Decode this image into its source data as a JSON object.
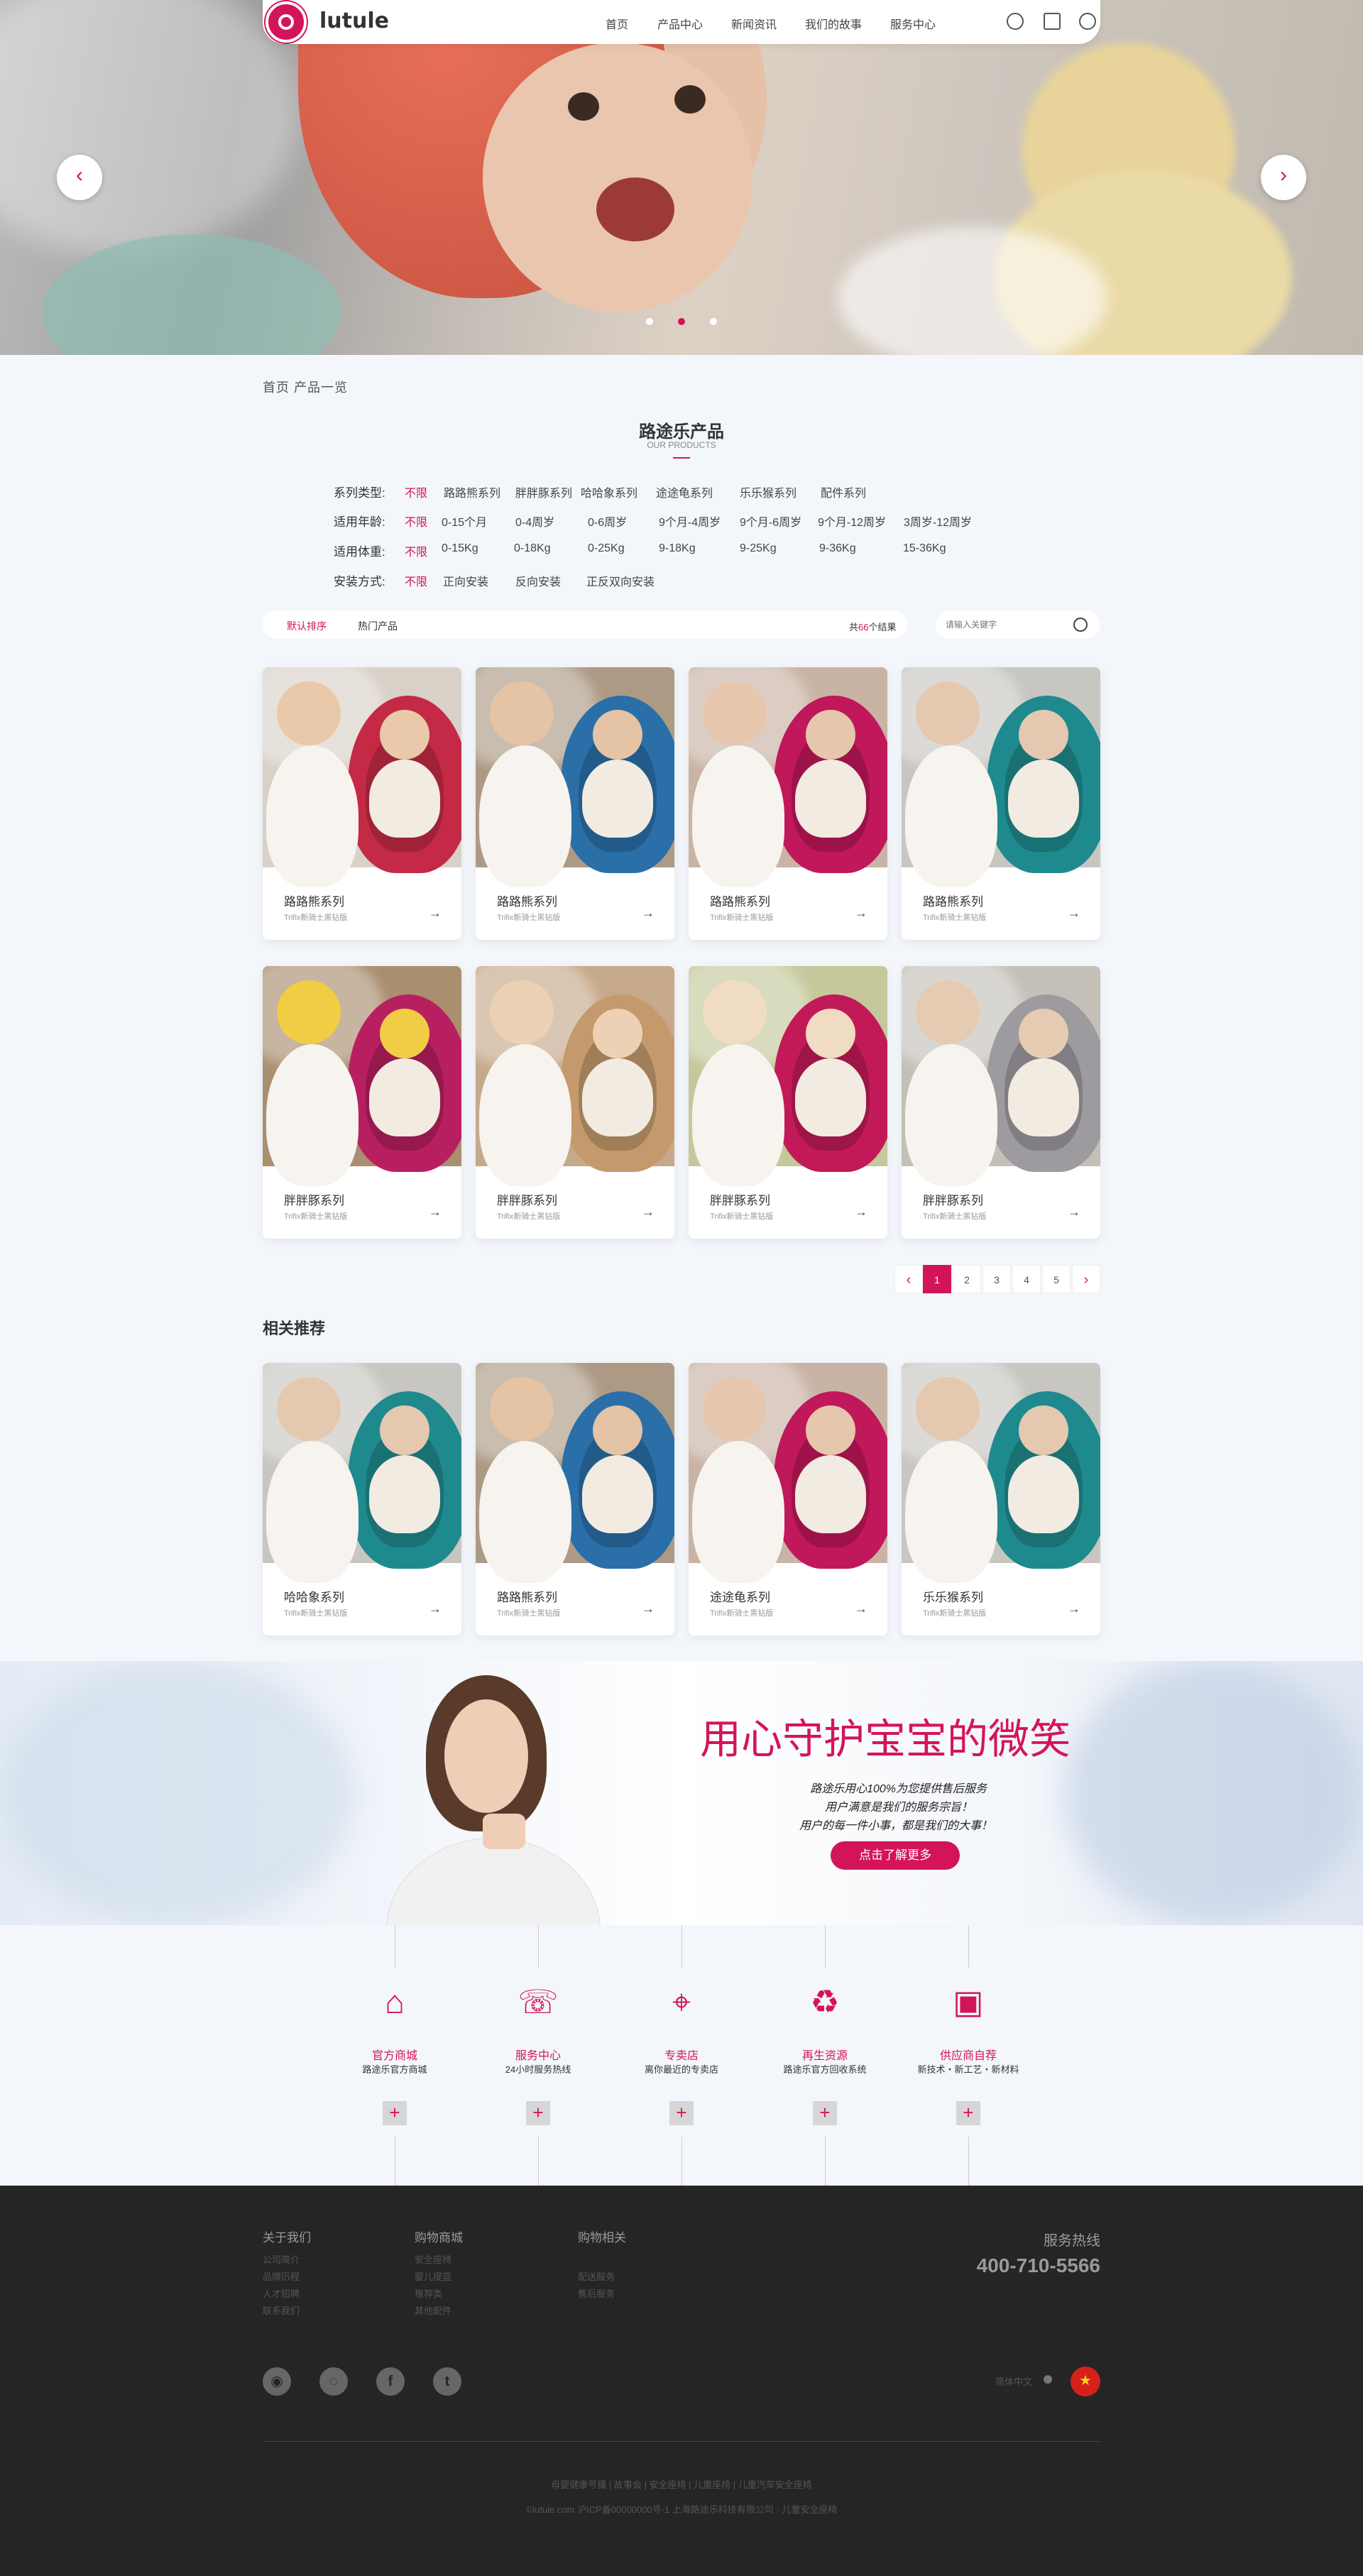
{
  "brand": {
    "logo_text": "lutule",
    "primary_color": "#d4145a"
  },
  "nav": {
    "items": [
      "首页",
      "产品中心",
      "新闻资讯",
      "我们的故事",
      "服务中心"
    ],
    "icons": [
      "search-icon",
      "cart-icon",
      "user-icon"
    ]
  },
  "hero": {
    "slides": 3,
    "active_slide": 2
  },
  "breadcrumb": "首页  产品一览",
  "section": {
    "title": "路途乐产品",
    "subtitle": "OUR PRODUCTS"
  },
  "filters": [
    {
      "label": "系列类型:",
      "active": "不限",
      "options": [
        "路路熊系列",
        "胖胖豚系列",
        "哈哈象系列",
        "途途龟系列",
        "乐乐猴系列",
        "配件系列"
      ]
    },
    {
      "label": "适用年龄:",
      "active": "不限",
      "options": [
        "0-15个月",
        "0-4周岁",
        "0-6周岁",
        "9个月-4周岁",
        "9个月-6周岁",
        "9个月-12周岁",
        "3周岁-12周岁"
      ]
    },
    {
      "label": "适用体重:",
      "active": "不限",
      "options": [
        "0-15Kg",
        "0-18Kg",
        "0-25Kg",
        "9-18Kg",
        "9-25Kg",
        "9-36Kg",
        "15-36Kg"
      ]
    },
    {
      "label": "安装方式:",
      "active": "不限",
      "options": [
        "正向安装",
        "反向安装",
        "正反双向安装"
      ]
    }
  ],
  "sort": {
    "default": "默认排序",
    "hot": "热门产品",
    "count_prefix": "共",
    "count": "66",
    "count_suffix": "个结果",
    "search_placeholder": "请输入关键字"
  },
  "products_row1": [
    {
      "name": "路路熊系列",
      "sub": "Trifix新骑士黑钻版"
    },
    {
      "name": "路路熊系列",
      "sub": "Trifix新骑士黑钻版"
    },
    {
      "name": "路路熊系列",
      "sub": "Trifix新骑士黑钻版"
    },
    {
      "name": "路路熊系列",
      "sub": "Trifix新骑士黑钻版"
    }
  ],
  "products_row2": [
    {
      "name": "胖胖豚系列",
      "sub": "Trifix新骑士黑钻版"
    },
    {
      "name": "胖胖豚系列",
      "sub": "Trifix新骑士黑钻版"
    },
    {
      "name": "胖胖豚系列",
      "sub": "Trifix新骑士黑钻版"
    },
    {
      "name": "胖胖豚系列",
      "sub": "Trifix新骑士黑钻版"
    }
  ],
  "pagination": {
    "prev": "‹",
    "pages": [
      "1",
      "2",
      "3",
      "4",
      "5"
    ],
    "current": "1",
    "next": "›"
  },
  "related": {
    "title": "相关推荐",
    "items": [
      {
        "name": "哈哈象系列",
        "sub": "Trifix新骑士黑钻版"
      },
      {
        "name": "路路熊系列",
        "sub": "Trifix新骑士黑钻版"
      },
      {
        "name": "途途龟系列",
        "sub": "Trifix新骑士黑钻版"
      },
      {
        "name": "乐乐猴系列",
        "sub": "Trifix新骑士黑钻版"
      }
    ]
  },
  "banner": {
    "headline": "用心守护宝宝的微笑",
    "lines": [
      "路途乐用心100%为您提供售后服务",
      "用户满意是我们的服务宗旨！",
      "用户的每一件小事，都是我们的大事！"
    ],
    "button": "点击了解更多"
  },
  "services": [
    {
      "title": "官方商城",
      "sub": "路途乐官方商城",
      "icon": "store-icon",
      "glyph": "⌂"
    },
    {
      "title": "服务中心",
      "sub": "24小时服务热线",
      "icon": "phone-24-icon",
      "glyph": "☏"
    },
    {
      "title": "专卖店",
      "sub": "离你最近的专卖店",
      "icon": "location-pin-icon",
      "glyph": "⌖"
    },
    {
      "title": "再生资源",
      "sub": "路途乐官方回收系统",
      "icon": "recycle-icon",
      "glyph": "♻"
    },
    {
      "title": "供应商自荐",
      "sub": "新技术・新工艺・新材料",
      "icon": "chip-icon",
      "glyph": "▣"
    }
  ],
  "footer": {
    "cols": [
      {
        "title": "关于我们",
        "links": [
          "公司简介",
          "品牌历程",
          "人才招聘",
          "联系我们"
        ]
      },
      {
        "title": "购物商城",
        "links": [
          "安全座椅",
          "婴儿提篮",
          "推荐类",
          "其他配件"
        ]
      },
      {
        "title": "购物相关",
        "links": [
          "",
          "配送服务",
          "售后服务"
        ]
      }
    ],
    "hotline_label": "服务热线",
    "hotline": "400-710-5566",
    "lang": "简体中文",
    "bottom_links": [
      "母婴健康号播",
      "故事会",
      "安全座椅",
      "儿童座椅",
      "儿童汽车安全座椅"
    ],
    "copyright": "©lutule.com 沪ICP备00000000号-1 上海路途乐科技有限公司 · 儿童安全座椅",
    "social_icons": [
      "weibo-icon",
      "wechat-icon",
      "facebook-icon",
      "twitter-icon"
    ]
  }
}
